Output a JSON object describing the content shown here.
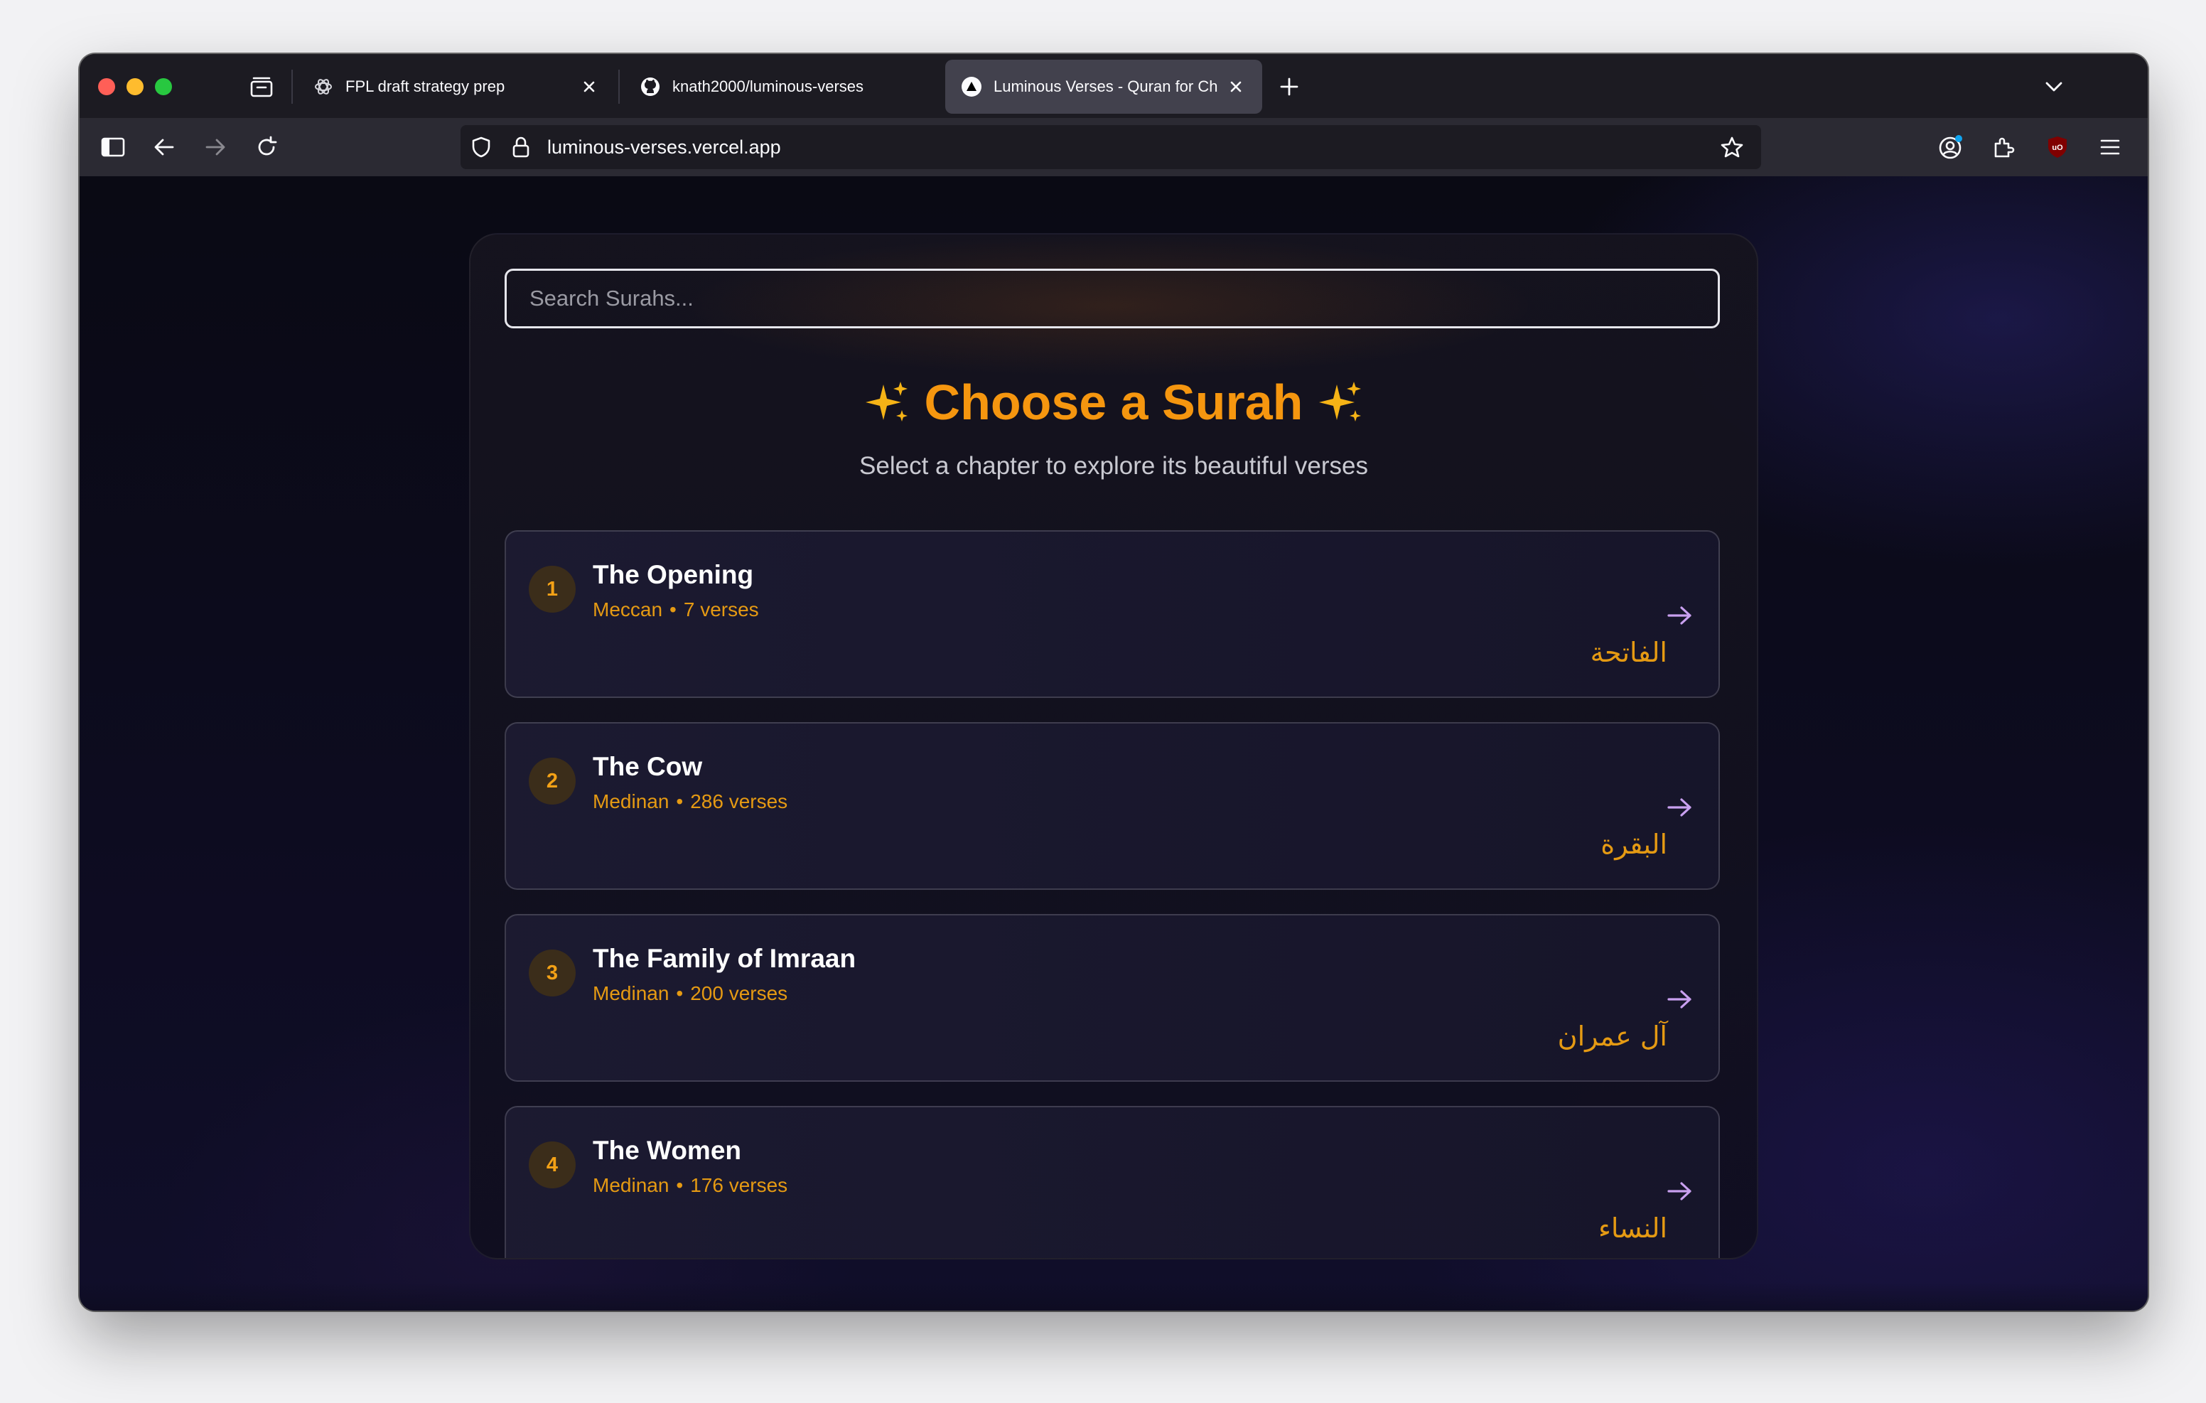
{
  "browser": {
    "tabs": [
      {
        "title": "FPL draft strategy prep",
        "favicon": "openai-icon",
        "active": false
      },
      {
        "title": "knath2000/luminous-verses",
        "favicon": "github-icon",
        "active": false
      },
      {
        "title": "Luminous Verses - Quran for Ch",
        "favicon": "vercel-icon",
        "active": true
      }
    ],
    "url": "luminous-verses.vercel.app"
  },
  "page": {
    "search_placeholder": "Search Surahs...",
    "heading": "Choose a Surah",
    "subheading": "Select a chapter to explore its beautiful verses",
    "accent_color": "#f5960f",
    "arrow_color": "#c9a0f0",
    "surahs": [
      {
        "number": "1",
        "name": "The Opening",
        "type": "Meccan",
        "dot": "•",
        "verses": "7 verses",
        "arabic": "الفاتحة"
      },
      {
        "number": "2",
        "name": "The Cow",
        "type": "Medinan",
        "dot": "•",
        "verses": "286 verses",
        "arabic": "البقرة"
      },
      {
        "number": "3",
        "name": "The Family of Imraan",
        "type": "Medinan",
        "dot": "•",
        "verses": "200 verses",
        "arabic": "آل عمران"
      },
      {
        "number": "4",
        "name": "The Women",
        "type": "Medinan",
        "dot": "•",
        "verses": "176 verses",
        "arabic": "النساء"
      }
    ]
  }
}
